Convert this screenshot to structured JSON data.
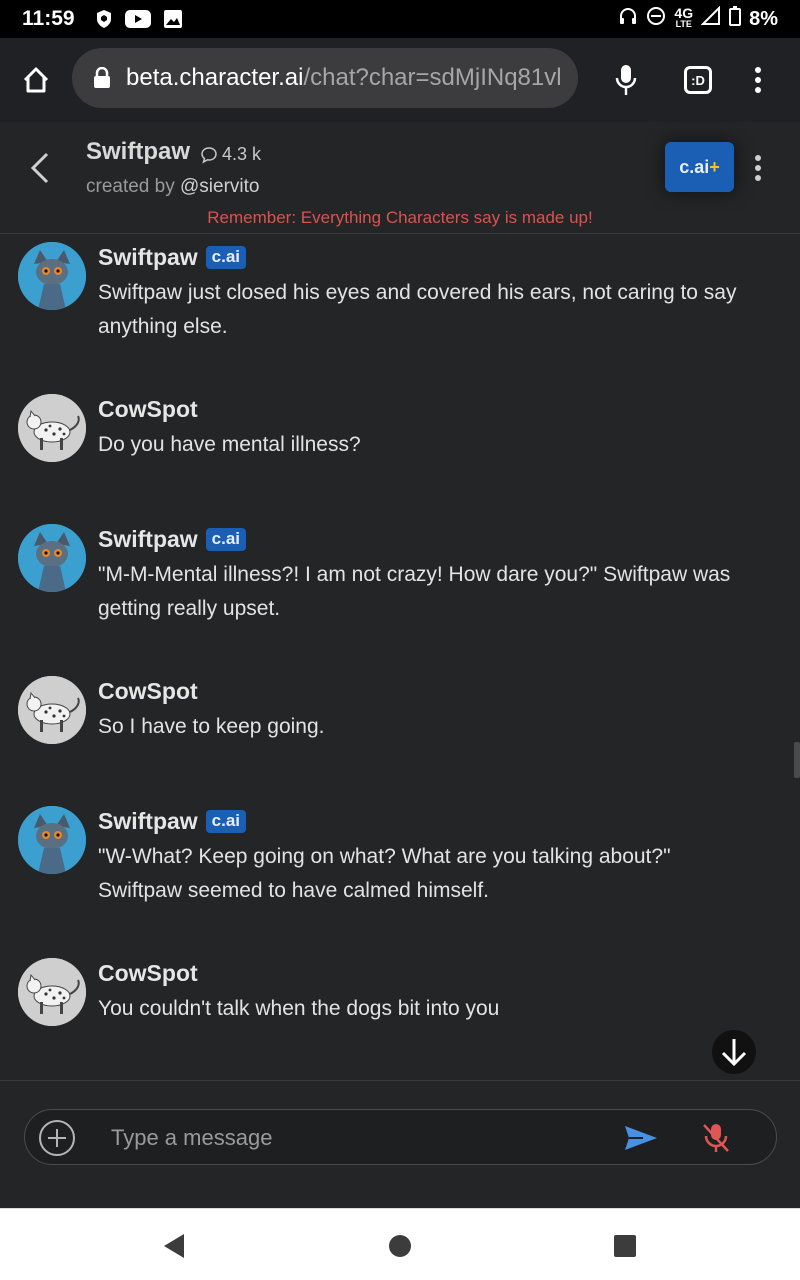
{
  "status_bar": {
    "time": "11:59",
    "network": "4G",
    "network_sub": "LTE",
    "battery": "8%",
    "icons": [
      "shield-icon",
      "youtube-icon",
      "image-icon",
      "headphones-icon",
      "dnd-icon",
      "signal-icon",
      "battery-icon"
    ]
  },
  "browser": {
    "url_host": "beta.character.ai",
    "url_path": "/chat?char=sdMjINq81vl",
    "tab_label": ":D"
  },
  "chat_header": {
    "name": "Swiftpaw",
    "interactions": "4.3 k",
    "created_by_label": "created by",
    "creator_handle": "@siervito",
    "plus_label": "c.ai",
    "plus_symbol": "+",
    "warning": "Remember: Everything Characters say is made up!"
  },
  "messages": [
    {
      "author": "Swiftpaw",
      "badge": "c.ai",
      "role": "bot",
      "text": "Swiftpaw just closed his eyes and covered his ears, not caring to say anything else."
    },
    {
      "author": "CowSpot",
      "badge": "",
      "role": "user",
      "text": "Do you have mental illness?"
    },
    {
      "author": "Swiftpaw",
      "badge": "c.ai",
      "role": "bot",
      "text": "\"M-M-Mental illness?! I am not crazy! How dare you?\" Swiftpaw was getting really upset."
    },
    {
      "author": "CowSpot",
      "badge": "",
      "role": "user",
      "text": "So I have to keep going."
    },
    {
      "author": "Swiftpaw",
      "badge": "c.ai",
      "role": "bot",
      "text": "\"W-What? Keep going on what? What are you talking about?\" Swiftpaw seemed to have calmed himself."
    },
    {
      "author": "CowSpot",
      "badge": "",
      "role": "user",
      "text": "You couldn't talk when the dogs bit into you"
    }
  ],
  "composer": {
    "placeholder": "Type a message"
  },
  "colors": {
    "background": "#242526",
    "accent_blue": "#1a5fb4",
    "warning_red": "#d9534f",
    "send_blue": "#4a90e2",
    "mic_red": "#e05555"
  }
}
